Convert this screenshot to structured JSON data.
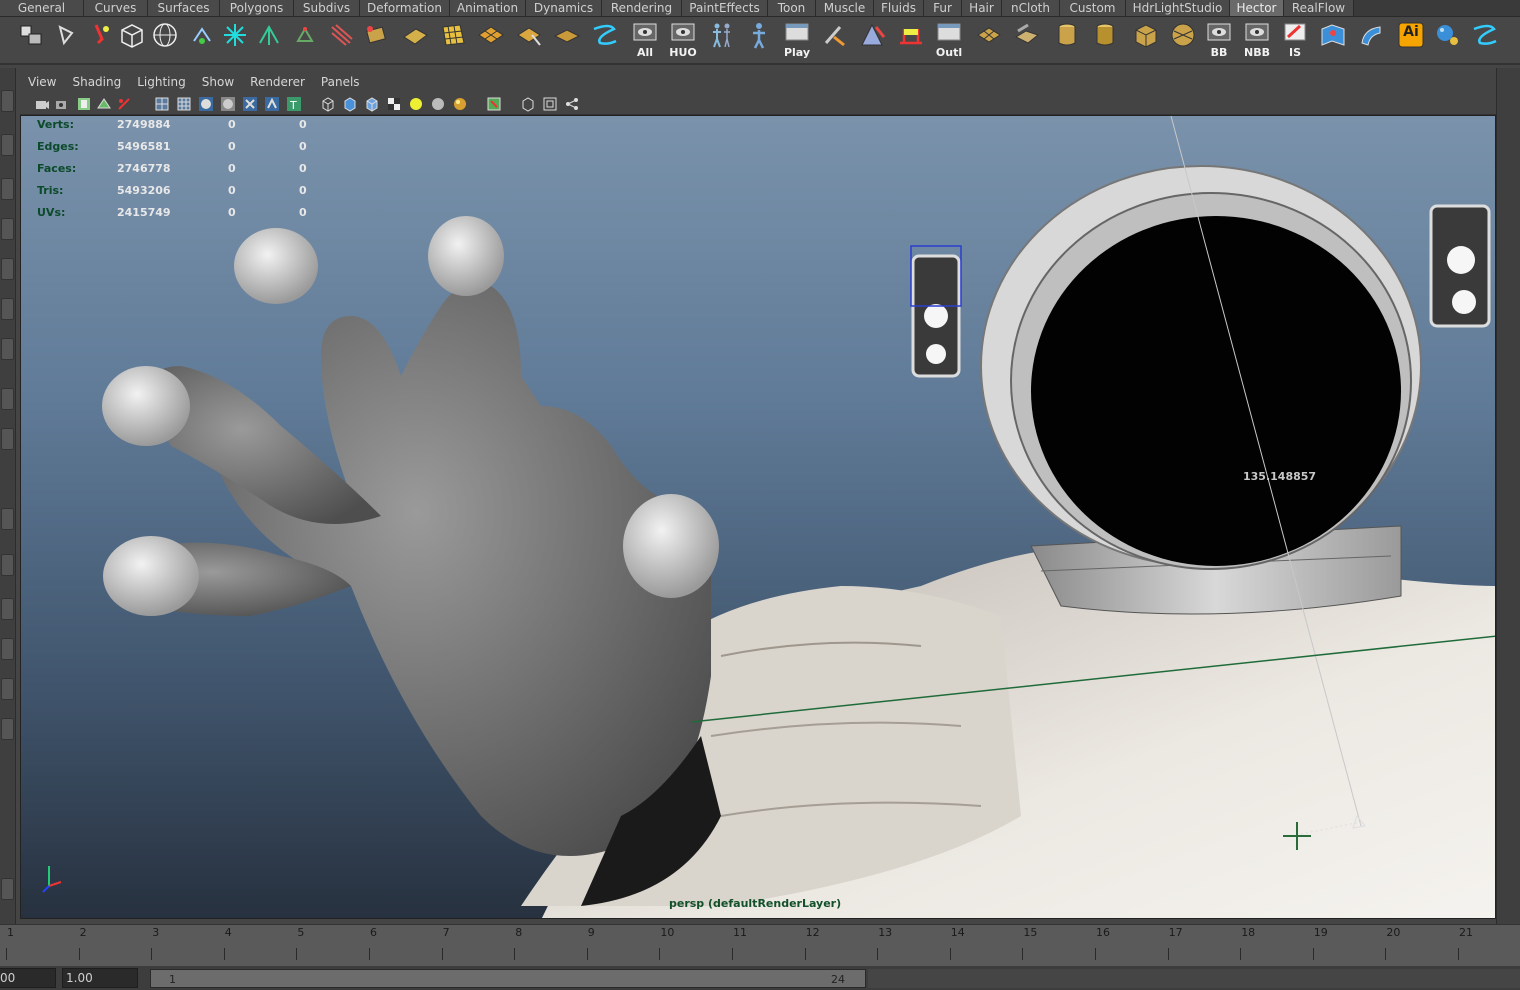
{
  "shelf": {
    "tabs": [
      "General",
      "Curves",
      "Surfaces",
      "Polygons",
      "Subdivs",
      "Deformation",
      "Animation",
      "Dynamics",
      "Rendering",
      "PaintEffects",
      "Toon",
      "Muscle",
      "Fluids",
      "Fur",
      "Hair",
      "nCloth",
      "Custom",
      "HdrLightStudio",
      "Hector",
      "RealFlow"
    ],
    "active_tab": "Hector",
    "icon_labels": {
      "all": "All",
      "huo": "HUO",
      "play": "Play",
      "outl": "Outl",
      "bb": "BB",
      "nbb": "NBB",
      "is": "IS",
      "ai": "Ai"
    }
  },
  "panel": {
    "menu": [
      "View",
      "Shading",
      "Lighting",
      "Show",
      "Renderer",
      "Panels"
    ]
  },
  "hud": {
    "rows": [
      {
        "key": "Verts:",
        "value": "2749884",
        "a": "0",
        "b": "0"
      },
      {
        "key": "Edges:",
        "value": "5496581",
        "a": "0",
        "b": "0"
      },
      {
        "key": "Faces:",
        "value": "2746778",
        "a": "0",
        "b": "0"
      },
      {
        "key": "Tris:",
        "value": "5493206",
        "a": "0",
        "b": "0"
      },
      {
        "key": "UVs:",
        "value": "2415749",
        "a": "0",
        "b": "0"
      }
    ]
  },
  "viewport": {
    "measure_value": "135.148857",
    "camera_label": "persp (defaultRenderLayer)"
  },
  "timeline": {
    "ticks": [
      "1",
      "2",
      "3",
      "4",
      "5",
      "6",
      "7",
      "8",
      "9",
      "10",
      "11",
      "12",
      "13",
      "14",
      "15",
      "16",
      "17",
      "18",
      "19",
      "20",
      "21"
    ]
  },
  "range": {
    "current_frame": "00",
    "start_time": "1.00",
    "range_start": "1",
    "range_end": "24"
  },
  "colors": {
    "hud_key": "#0b4a2a",
    "active_tab": "#6a6a6a",
    "viewport_top": "#7a92ab",
    "viewport_bottom": "#27313f"
  }
}
